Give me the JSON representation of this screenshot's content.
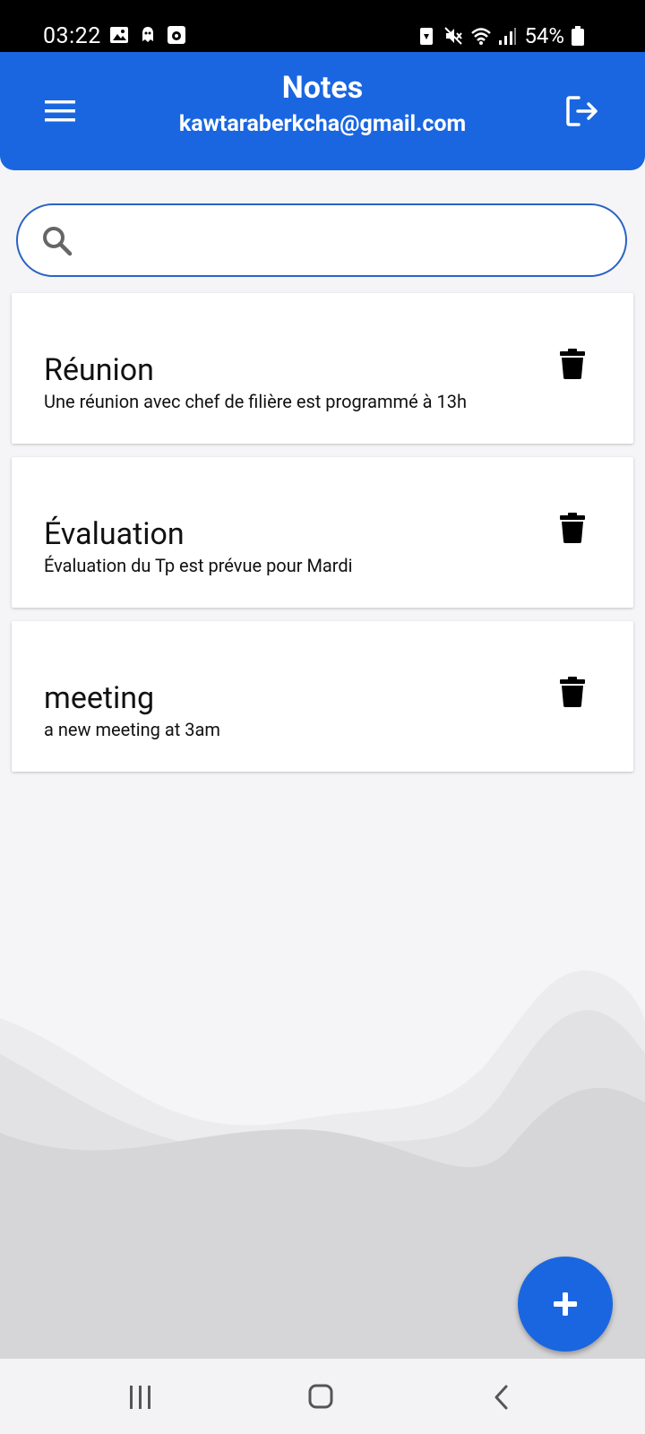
{
  "status_bar": {
    "time": "03:22",
    "battery": "54%",
    "left_icons": [
      "image-icon",
      "ghost-icon",
      "media-icon"
    ],
    "right_icons": [
      "battery-saver-icon",
      "mute-icon",
      "wifi-icon",
      "signal-icon",
      "battery-icon"
    ]
  },
  "app_bar": {
    "title": "Notes",
    "subtitle": "kawtaraberkcha@gmail.com",
    "menu_icon": "menu-icon",
    "logout_icon": "logout-icon",
    "color": "#1a66e0"
  },
  "search": {
    "placeholder": "",
    "value": "",
    "icon": "search-icon",
    "border_color": "#2a63c4"
  },
  "notes": [
    {
      "title": "Réunion",
      "body": "Une réunion avec chef de filière est programmé à 13h"
    },
    {
      "title": "Évaluation",
      "body": "Évaluation du Tp est prévue pour Mardi"
    },
    {
      "title": "meeting",
      "body": "a new meeting at 3am"
    }
  ],
  "fab": {
    "icon": "plus-icon",
    "color": "#1a66e0"
  },
  "nav_bar": {
    "icons": [
      "recents-icon",
      "home-icon",
      "back-icon"
    ]
  }
}
